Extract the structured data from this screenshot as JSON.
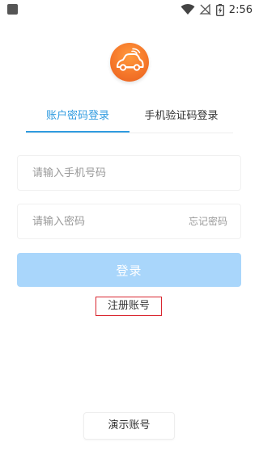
{
  "status_bar": {
    "time": "2:56",
    "icons": [
      "notification-square-icon",
      "wifi-icon",
      "no-signal-icon",
      "battery-charging-icon"
    ]
  },
  "logo": {
    "icon": "car-signal-logo-icon",
    "color": "#f5772a"
  },
  "tabs": [
    {
      "label": "账户密码登录",
      "active": true
    },
    {
      "label": "手机验证码登录",
      "active": false
    }
  ],
  "form": {
    "phone_placeholder": "请输入手机号码",
    "password_placeholder": "请输入密码",
    "forgot_label": "忘记密码",
    "login_label": "登录",
    "register_label": "注册账号"
  },
  "demo": {
    "label": "演示账号"
  },
  "colors": {
    "accent": "#2f9be0",
    "login_button": "#a9d6fb",
    "highlight_border": "#d9262f"
  }
}
